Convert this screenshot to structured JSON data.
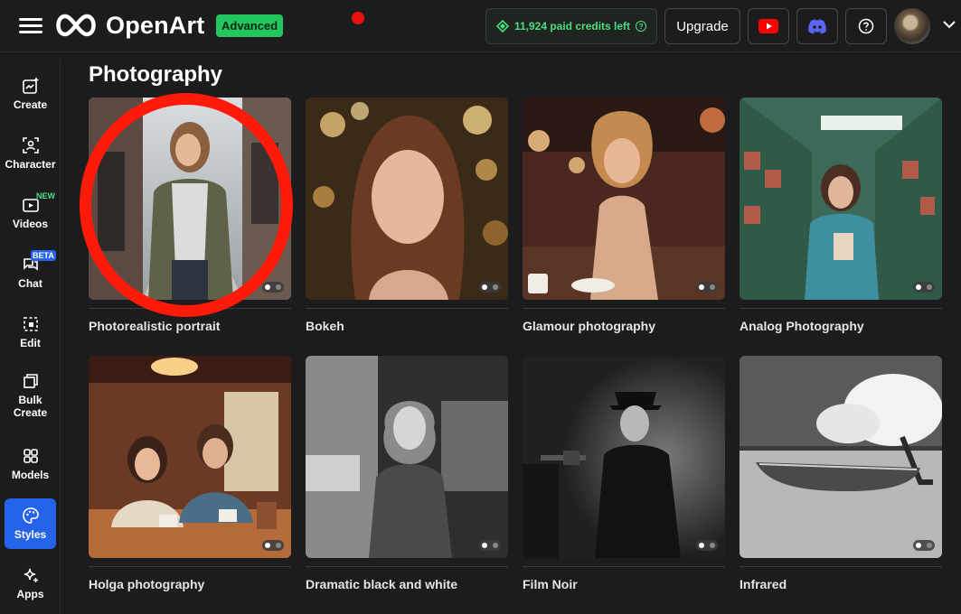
{
  "header": {
    "logo_text": "OpenArt",
    "badge": "Advanced",
    "credits": "11,924 paid credits left",
    "upgrade_label": "Upgrade",
    "colors": {
      "accent_green": "#22c55e",
      "credit_green": "#4ade80",
      "youtube_red": "#ff0000",
      "discord_blurple": "#5865f2"
    }
  },
  "sidebar": {
    "items": [
      {
        "label": "Create",
        "icon": "create-icon"
      },
      {
        "label": "Character",
        "icon": "character-icon"
      },
      {
        "label": "Videos",
        "icon": "video-icon",
        "tag": "NEW"
      },
      {
        "label": "Chat",
        "icon": "chat-icon",
        "tag": "BETA"
      },
      {
        "label": "Edit",
        "icon": "edit-icon"
      },
      {
        "label": "Bulk Create",
        "icon": "bulk-create-icon"
      },
      {
        "label": "Models",
        "icon": "models-icon"
      },
      {
        "label": "Styles",
        "icon": "palette-icon",
        "active": true
      },
      {
        "label": "Apps",
        "icon": "sparkle-icon"
      }
    ]
  },
  "main": {
    "section_title": "Photography",
    "cards": [
      {
        "title": "Photorealistic portrait"
      },
      {
        "title": "Bokeh"
      },
      {
        "title": "Glamour photography"
      },
      {
        "title": "Analog Photography"
      },
      {
        "title": "Holga photography"
      },
      {
        "title": "Dramatic black and white"
      },
      {
        "title": "Film Noir"
      },
      {
        "title": "Infrared"
      }
    ]
  }
}
